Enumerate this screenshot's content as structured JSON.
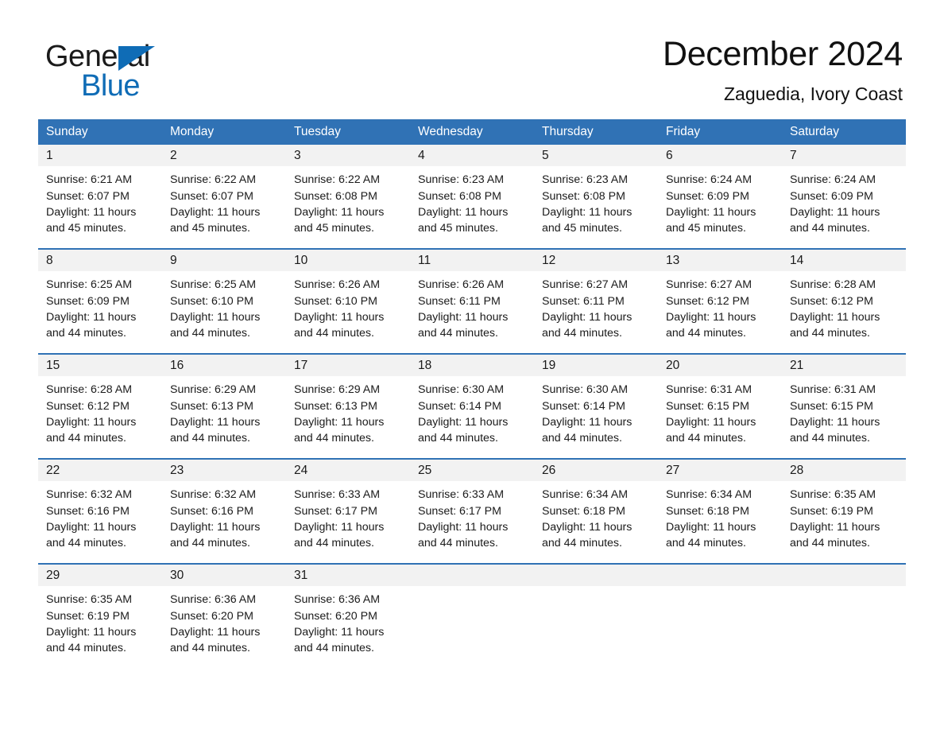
{
  "brand": {
    "name_part1": "General",
    "name_part2": "Blue",
    "accent_color": "#0f6cb6"
  },
  "header": {
    "title": "December 2024",
    "location": "Zaguedia, Ivory Coast"
  },
  "theme": {
    "header_blue": "#3072b5",
    "daynum_strip": "#f2f2f2",
    "text": "#1a1a1a"
  },
  "weekdays": [
    "Sunday",
    "Monday",
    "Tuesday",
    "Wednesday",
    "Thursday",
    "Friday",
    "Saturday"
  ],
  "weeks": [
    [
      {
        "day": "1",
        "sunrise": "Sunrise: 6:21 AM",
        "sunset": "Sunset: 6:07 PM",
        "daylight1": "Daylight: 11 hours",
        "daylight2": "and 45 minutes."
      },
      {
        "day": "2",
        "sunrise": "Sunrise: 6:22 AM",
        "sunset": "Sunset: 6:07 PM",
        "daylight1": "Daylight: 11 hours",
        "daylight2": "and 45 minutes."
      },
      {
        "day": "3",
        "sunrise": "Sunrise: 6:22 AM",
        "sunset": "Sunset: 6:08 PM",
        "daylight1": "Daylight: 11 hours",
        "daylight2": "and 45 minutes."
      },
      {
        "day": "4",
        "sunrise": "Sunrise: 6:23 AM",
        "sunset": "Sunset: 6:08 PM",
        "daylight1": "Daylight: 11 hours",
        "daylight2": "and 45 minutes."
      },
      {
        "day": "5",
        "sunrise": "Sunrise: 6:23 AM",
        "sunset": "Sunset: 6:08 PM",
        "daylight1": "Daylight: 11 hours",
        "daylight2": "and 45 minutes."
      },
      {
        "day": "6",
        "sunrise": "Sunrise: 6:24 AM",
        "sunset": "Sunset: 6:09 PM",
        "daylight1": "Daylight: 11 hours",
        "daylight2": "and 45 minutes."
      },
      {
        "day": "7",
        "sunrise": "Sunrise: 6:24 AM",
        "sunset": "Sunset: 6:09 PM",
        "daylight1": "Daylight: 11 hours",
        "daylight2": "and 44 minutes."
      }
    ],
    [
      {
        "day": "8",
        "sunrise": "Sunrise: 6:25 AM",
        "sunset": "Sunset: 6:09 PM",
        "daylight1": "Daylight: 11 hours",
        "daylight2": "and 44 minutes."
      },
      {
        "day": "9",
        "sunrise": "Sunrise: 6:25 AM",
        "sunset": "Sunset: 6:10 PM",
        "daylight1": "Daylight: 11 hours",
        "daylight2": "and 44 minutes."
      },
      {
        "day": "10",
        "sunrise": "Sunrise: 6:26 AM",
        "sunset": "Sunset: 6:10 PM",
        "daylight1": "Daylight: 11 hours",
        "daylight2": "and 44 minutes."
      },
      {
        "day": "11",
        "sunrise": "Sunrise: 6:26 AM",
        "sunset": "Sunset: 6:11 PM",
        "daylight1": "Daylight: 11 hours",
        "daylight2": "and 44 minutes."
      },
      {
        "day": "12",
        "sunrise": "Sunrise: 6:27 AM",
        "sunset": "Sunset: 6:11 PM",
        "daylight1": "Daylight: 11 hours",
        "daylight2": "and 44 minutes."
      },
      {
        "day": "13",
        "sunrise": "Sunrise: 6:27 AM",
        "sunset": "Sunset: 6:12 PM",
        "daylight1": "Daylight: 11 hours",
        "daylight2": "and 44 minutes."
      },
      {
        "day": "14",
        "sunrise": "Sunrise: 6:28 AM",
        "sunset": "Sunset: 6:12 PM",
        "daylight1": "Daylight: 11 hours",
        "daylight2": "and 44 minutes."
      }
    ],
    [
      {
        "day": "15",
        "sunrise": "Sunrise: 6:28 AM",
        "sunset": "Sunset: 6:12 PM",
        "daylight1": "Daylight: 11 hours",
        "daylight2": "and 44 minutes."
      },
      {
        "day": "16",
        "sunrise": "Sunrise: 6:29 AM",
        "sunset": "Sunset: 6:13 PM",
        "daylight1": "Daylight: 11 hours",
        "daylight2": "and 44 minutes."
      },
      {
        "day": "17",
        "sunrise": "Sunrise: 6:29 AM",
        "sunset": "Sunset: 6:13 PM",
        "daylight1": "Daylight: 11 hours",
        "daylight2": "and 44 minutes."
      },
      {
        "day": "18",
        "sunrise": "Sunrise: 6:30 AM",
        "sunset": "Sunset: 6:14 PM",
        "daylight1": "Daylight: 11 hours",
        "daylight2": "and 44 minutes."
      },
      {
        "day": "19",
        "sunrise": "Sunrise: 6:30 AM",
        "sunset": "Sunset: 6:14 PM",
        "daylight1": "Daylight: 11 hours",
        "daylight2": "and 44 minutes."
      },
      {
        "day": "20",
        "sunrise": "Sunrise: 6:31 AM",
        "sunset": "Sunset: 6:15 PM",
        "daylight1": "Daylight: 11 hours",
        "daylight2": "and 44 minutes."
      },
      {
        "day": "21",
        "sunrise": "Sunrise: 6:31 AM",
        "sunset": "Sunset: 6:15 PM",
        "daylight1": "Daylight: 11 hours",
        "daylight2": "and 44 minutes."
      }
    ],
    [
      {
        "day": "22",
        "sunrise": "Sunrise: 6:32 AM",
        "sunset": "Sunset: 6:16 PM",
        "daylight1": "Daylight: 11 hours",
        "daylight2": "and 44 minutes."
      },
      {
        "day": "23",
        "sunrise": "Sunrise: 6:32 AM",
        "sunset": "Sunset: 6:16 PM",
        "daylight1": "Daylight: 11 hours",
        "daylight2": "and 44 minutes."
      },
      {
        "day": "24",
        "sunrise": "Sunrise: 6:33 AM",
        "sunset": "Sunset: 6:17 PM",
        "daylight1": "Daylight: 11 hours",
        "daylight2": "and 44 minutes."
      },
      {
        "day": "25",
        "sunrise": "Sunrise: 6:33 AM",
        "sunset": "Sunset: 6:17 PM",
        "daylight1": "Daylight: 11 hours",
        "daylight2": "and 44 minutes."
      },
      {
        "day": "26",
        "sunrise": "Sunrise: 6:34 AM",
        "sunset": "Sunset: 6:18 PM",
        "daylight1": "Daylight: 11 hours",
        "daylight2": "and 44 minutes."
      },
      {
        "day": "27",
        "sunrise": "Sunrise: 6:34 AM",
        "sunset": "Sunset: 6:18 PM",
        "daylight1": "Daylight: 11 hours",
        "daylight2": "and 44 minutes."
      },
      {
        "day": "28",
        "sunrise": "Sunrise: 6:35 AM",
        "sunset": "Sunset: 6:19 PM",
        "daylight1": "Daylight: 11 hours",
        "daylight2": "and 44 minutes."
      }
    ],
    [
      {
        "day": "29",
        "sunrise": "Sunrise: 6:35 AM",
        "sunset": "Sunset: 6:19 PM",
        "daylight1": "Daylight: 11 hours",
        "daylight2": "and 44 minutes."
      },
      {
        "day": "30",
        "sunrise": "Sunrise: 6:36 AM",
        "sunset": "Sunset: 6:20 PM",
        "daylight1": "Daylight: 11 hours",
        "daylight2": "and 44 minutes."
      },
      {
        "day": "31",
        "sunrise": "Sunrise: 6:36 AM",
        "sunset": "Sunset: 6:20 PM",
        "daylight1": "Daylight: 11 hours",
        "daylight2": "and 44 minutes."
      },
      {
        "day": "",
        "sunrise": "",
        "sunset": "",
        "daylight1": "",
        "daylight2": ""
      },
      {
        "day": "",
        "sunrise": "",
        "sunset": "",
        "daylight1": "",
        "daylight2": ""
      },
      {
        "day": "",
        "sunrise": "",
        "sunset": "",
        "daylight1": "",
        "daylight2": ""
      },
      {
        "day": "",
        "sunrise": "",
        "sunset": "",
        "daylight1": "",
        "daylight2": ""
      }
    ]
  ]
}
